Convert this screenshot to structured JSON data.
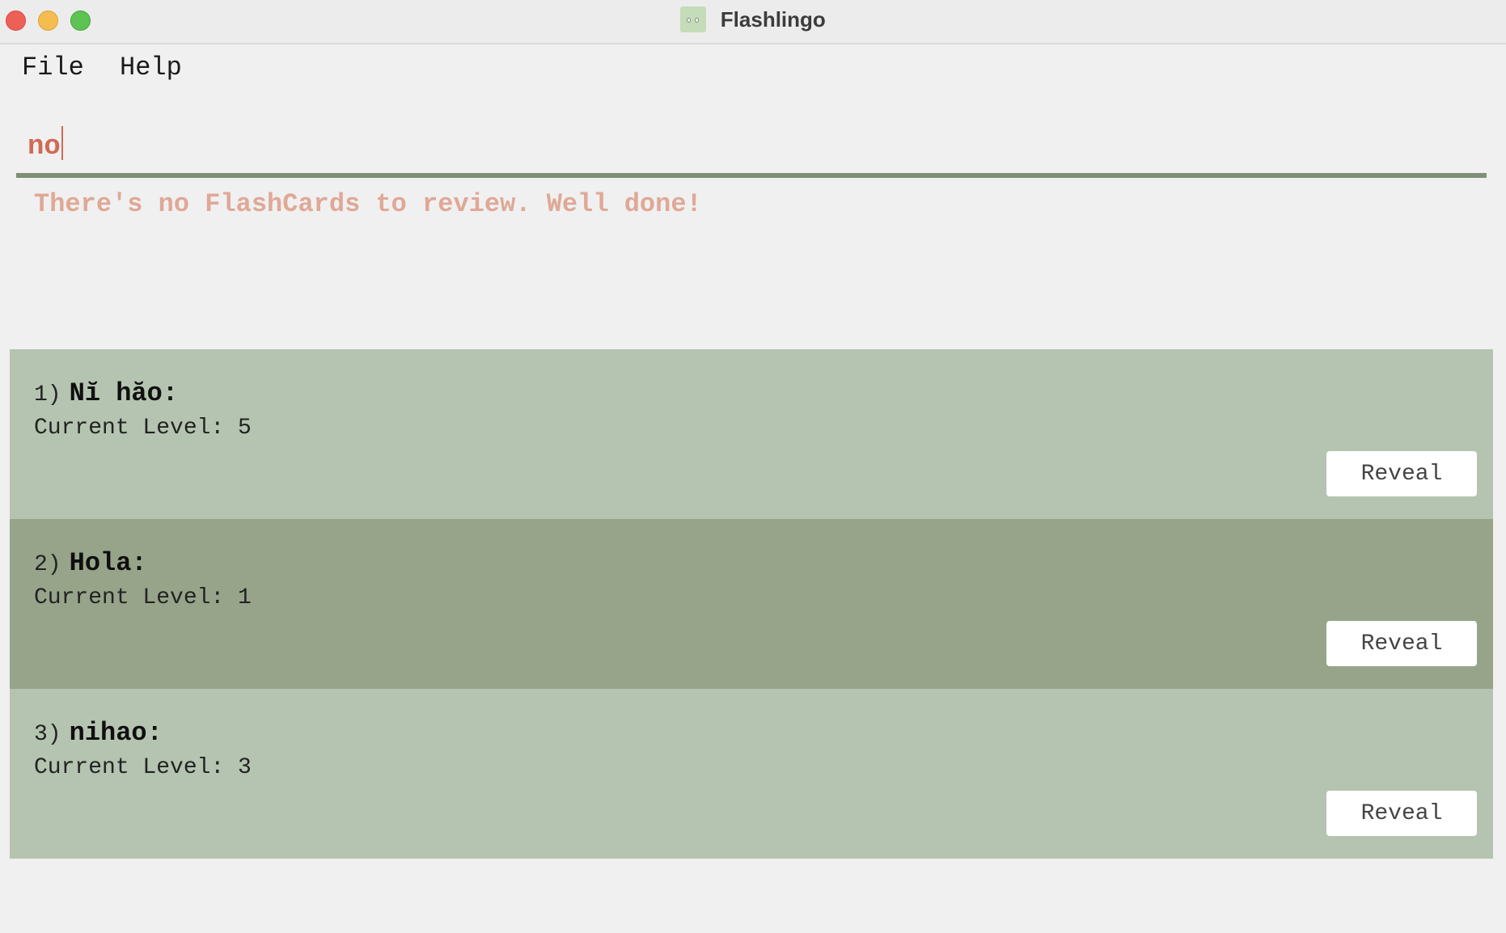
{
  "window": {
    "title": "Flashlingo"
  },
  "menu": {
    "file": "File",
    "help": "Help"
  },
  "command": {
    "value": "no"
  },
  "result": {
    "message": "There's no FlashCards to review. Well done!"
  },
  "cards": [
    {
      "index": "1)",
      "word": "Nĭ hăo:",
      "level": "Current Level: 5",
      "button": "Reveal"
    },
    {
      "index": "2)",
      "word": "Hola:",
      "level": "Current Level: 1",
      "button": "Reveal"
    },
    {
      "index": "3)",
      "word": "nihao:",
      "level": "Current Level: 3",
      "button": "Reveal"
    }
  ],
  "colors": {
    "card_light": "#b4c4b0",
    "card_dark": "#97a48a",
    "command_text": "#d06a55",
    "result_text": "#dfa896",
    "command_border": "#7e8f75"
  },
  "icons": {
    "app": "owl-eyes-icon"
  }
}
